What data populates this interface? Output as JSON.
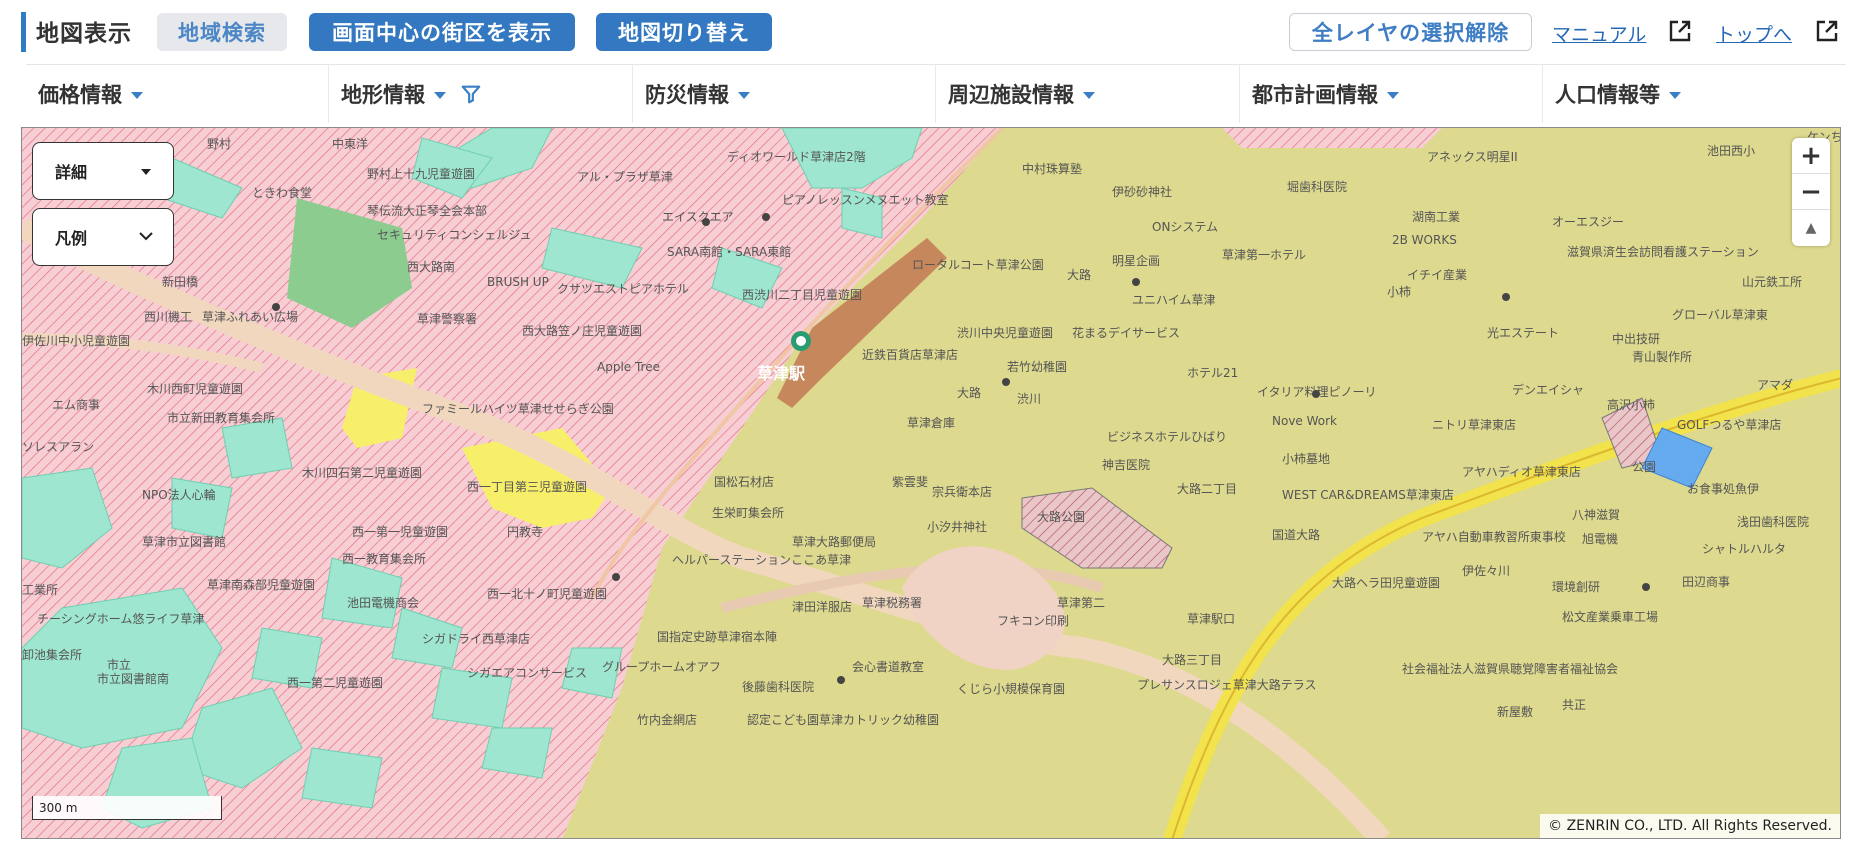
{
  "header": {
    "title": "地図表示",
    "region_search": "地域検索",
    "show_center_block": "画面中心の街区を表示",
    "switch_map": "地図切り替え",
    "clear_layers": "全レイヤの選択解除",
    "manual": "マニュアル",
    "top": "トップへ"
  },
  "categories": [
    {
      "label": "価格情報"
    },
    {
      "label": "地形情報"
    },
    {
      "label": "防災情報"
    },
    {
      "label": "周辺施設情報"
    },
    {
      "label": "都市計画情報"
    },
    {
      "label": "人口情報等"
    }
  ],
  "map_controls": {
    "detail_select": "詳細",
    "legend_select": "凡例",
    "zoom_in": "+",
    "zoom_out": "−",
    "north": "▲",
    "scale": "300 m",
    "copyright": "© ZENRIN CO., LTD. All Rights Reserved."
  },
  "map_labels": {
    "l1": "野村",
    "l2": "中東洋",
    "l3": "野村上十九児童遊園",
    "l4": "アル・プラザ草津",
    "l5": "ディオワールド草津店2階",
    "l6": "ときわ食堂",
    "l7": "琴伝流大正琴全会本部",
    "l8": "ピアノレッスンメヌエット教室",
    "l9": "エイスクエア",
    "l10": "中村珠算塾",
    "l11": "伊砂砂神社",
    "l12": "ONシステム",
    "l13": "アネックス明星II",
    "l14": "堀歯科医院",
    "l15": "湖南工業",
    "l16": "オーエスジー",
    "l17": "2B WORKS",
    "l18": "イチイ産業",
    "l19": "滋賀県済生会訪問看護ステーション",
    "l20": "山元鉄工所",
    "l21": "グローバル草津東",
    "l22": "光エステート",
    "l23": "中出技研",
    "l24": "青山製作所",
    "l25": "アマダ",
    "l26": "デンエイシャ",
    "l27": "GOLFつるや草津店",
    "l28": "お食事処魚伊",
    "l29": "浅田歯科医院",
    "l30": "八神滋賀",
    "l31": "旭電機",
    "l32": "シャトルハルタ",
    "l33": "田辺商事",
    "l34": "環境創研",
    "l35": "松文産業乗車工場",
    "l36": "社会福祉法人滋賀県聴覚障害者福祉協会",
    "l37": "共正",
    "l38": "西大路南",
    "l39": "BRUSH UP",
    "l40": "クサツエストピアホテル",
    "l41": "SARA南館・SARA東館",
    "l42": "西渋川二丁目児童遊園",
    "l43": "草津警察署",
    "l44": "西大路笠ノ庄児童遊園",
    "l45": "Apple Tree",
    "l46": "近鉄百貨店草津店",
    "l47": "草津駅",
    "l48": "ロータルコート草津公園",
    "l49": "渋川中央児童遊園",
    "l50": "花まるデイサービス",
    "l51": "若竹幼稚園",
    "l52": "ホテル21",
    "l53": "ユニハイム草津",
    "l54": "明星企画",
    "l55": "草津第一ホテル",
    "l56": "大路",
    "l57": "渋川",
    "l58": "草津倉庫",
    "l59": "ビジネスホテルひばり",
    "l60": "神吉医院",
    "l61": "イタリア料理ピノーリ",
    "l62": "Nove Work",
    "l63": "小柿墓地",
    "l64": "ニトリ草津東店",
    "l65": "アヤハディオ草津東店",
    "l66": "大路二丁目",
    "l67": "WEST CAR&DREAMS草津東店",
    "l68": "アヤハ自動車教習所東事校",
    "l69": "国道大路",
    "l70": "伊佐々川",
    "l71": "大路ヘラ田児童遊園",
    "l72": "新屋敷",
    "l73": "市立新田教育集会所",
    "l74": "新田橋",
    "l75": "西川機工",
    "l76": "草津ふれあい広場",
    "l77": "木川西町児童遊園",
    "l78": "エム商事",
    "l79": "木川四石第二児童遊園",
    "l80": "西一丁目第三児童遊園",
    "l81": "ファミールハイツ草津せせらぎ公園",
    "l82": "NPO法人心輪",
    "l83": "草津市立図書館",
    "l84": "西一第一児童遊園",
    "l85": "円教寺",
    "l86": "西一教育集会所",
    "l87": "草津南森部児童遊園",
    "l88": "池田電機商会",
    "l89": "西一北十ノ町児童遊園",
    "l90": "シガドライ西草津店",
    "l91": "シガエアコンサービス",
    "l92": "グループホームオアフ",
    "l93": "後藤歯科医院",
    "l94": "会心書道教室",
    "l95": "くじら小規模保育園",
    "l96": "認定こども園草津カトリック幼稚園",
    "l97": "竹内金網店",
    "l98": "国指定史跡草津宿本陣",
    "l99": "草津税務署",
    "l100": "草津第二",
    "l101": "フキコン印刷",
    "l102": "草津駅口",
    "l103": "大路三丁目",
    "l104": "プレサンスロジェ草津大路テラス",
    "l105": "大路公園",
    "l106": "宗兵衛本店",
    "l107": "紫雲斐",
    "l108": "小汐井神社",
    "l109": "草津大路郵便局",
    "l110": "生栄町集会所",
    "l111": "国松石材店",
    "l112": "ヘルパーステーションここあ草津",
    "l113": "津田洋服店",
    "l114": "西一第二児童遊園",
    "l115": "市立図書館南",
    "l116": "卸池集会所",
    "l117": "チーシングホーム悠ライフ草津",
    "l118": "工業所",
    "l119": "市立",
    "l120": "伊佐川中小児童遊園",
    "l121": "小柿",
    "l122": "大路",
    "l123": "ソレスアラン",
    "l124": "セキュリティコンシェルジュ",
    "l125": "高沢小柿",
    "l126": "公園",
    "l127": "池田西小",
    "l128": "ケンち"
  },
  "colors": {
    "accent": "#3378c0",
    "zone_pink": "#f5c9cf",
    "zone_yellow": "#ddd98e",
    "zone_green": "#9ee6cf",
    "zone_lemon": "#f7ef6a",
    "road": "#f2d7bf"
  },
  "icons": [
    "external-link-icon",
    "filter-icon",
    "caret-down-icon",
    "station-icon",
    "park-icon",
    "shrine-icon",
    "hospital-icon",
    "parking-icon"
  ]
}
